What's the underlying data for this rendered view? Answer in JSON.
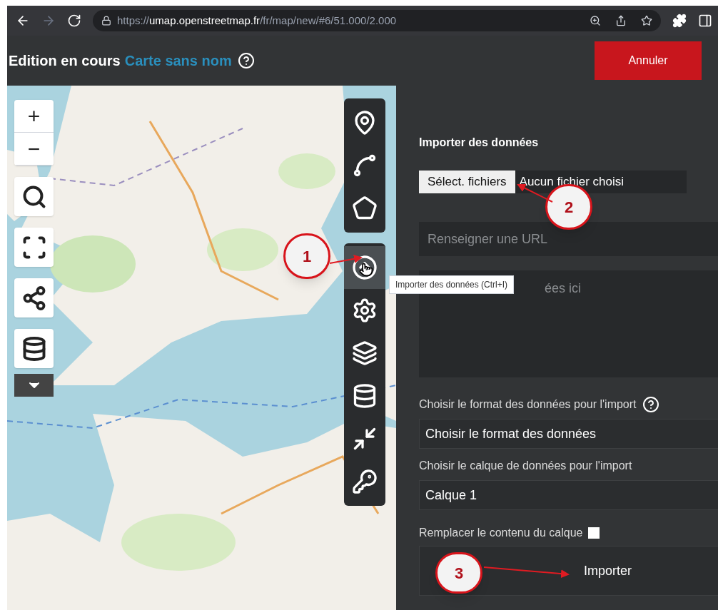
{
  "browser": {
    "url_scheme": "https://",
    "url_host": "umap.openstreetmap.fr",
    "url_path": "/fr/map/new/#6/51.000/2.000"
  },
  "header": {
    "status": "Edition en cours",
    "map_name": "Carte sans nom",
    "cancel_button": "Annuler"
  },
  "map_controls": [
    {
      "kind": "zoom_in",
      "label": "+"
    },
    {
      "kind": "zoom_out",
      "label": "−"
    },
    {
      "kind": "search"
    },
    {
      "kind": "fullscreen"
    },
    {
      "kind": "share"
    },
    {
      "kind": "data"
    },
    {
      "kind": "more"
    }
  ],
  "edit_tool_groups": [
    {
      "tools": [
        {
          "kind": "marker",
          "selected": false
        },
        {
          "kind": "line",
          "selected": false
        },
        {
          "kind": "polygon",
          "selected": false
        }
      ]
    },
    {
      "tools": [
        {
          "kind": "import",
          "selected": true
        },
        {
          "kind": "settings",
          "selected": false
        },
        {
          "kind": "layers",
          "selected": false
        },
        {
          "kind": "data",
          "selected": false
        },
        {
          "kind": "center",
          "selected": false
        },
        {
          "kind": "permissions",
          "selected": false
        }
      ]
    }
  ],
  "tooltip": "Importer des données (Ctrl+I)",
  "import_panel": {
    "title": "Importer des données",
    "file_button": "Sélect. fichiers",
    "file_status": "Aucun fichier choisi",
    "url_placeholder": "Renseigner une URL",
    "textarea_placeholder": "ées ici",
    "format_label": "Choisir le format des données pour l'import",
    "format_value": "Choisir le format des données",
    "layer_label": "Choisir le calque de données pour l'import",
    "layer_value": "Calque 1",
    "replace_label": "Remplacer le contenu du calque",
    "replace_checked": false,
    "import_button": "Importer"
  },
  "callouts": [
    {
      "label": "1"
    },
    {
      "label": "2"
    },
    {
      "label": "3"
    }
  ]
}
